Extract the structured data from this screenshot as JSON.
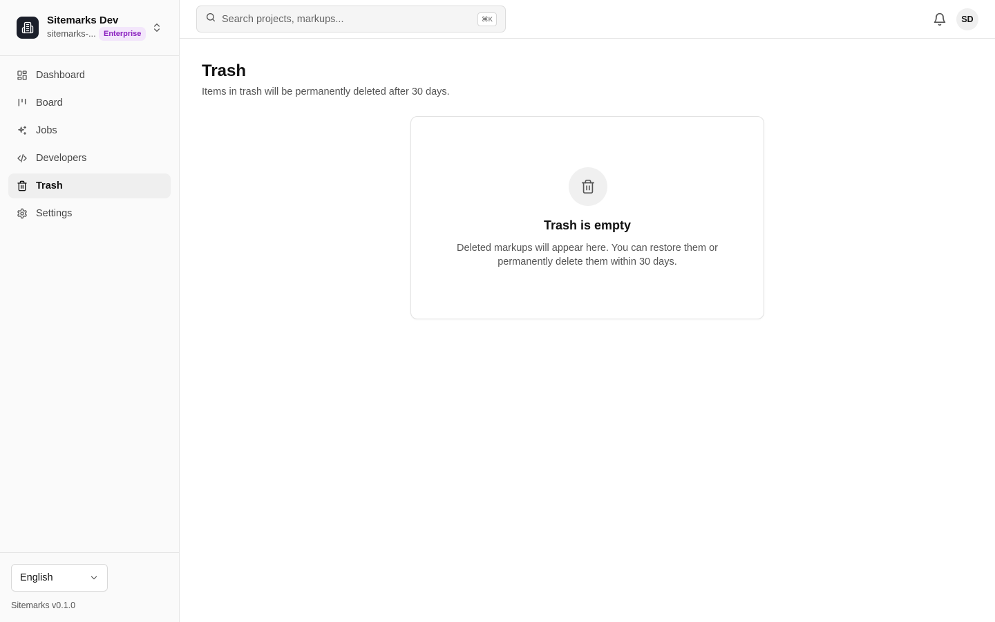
{
  "workspace": {
    "name": "Sitemarks Dev",
    "slug": "sitemarks-...",
    "badge": "Enterprise",
    "logo_icon": "building-icon",
    "switcher_icon": "chevrons-up-down-icon",
    "badge_color": "#8a1fbf"
  },
  "sidebar": {
    "items": [
      {
        "label": "Dashboard",
        "icon": "dashboard-icon",
        "active": false
      },
      {
        "label": "Board",
        "icon": "board-icon",
        "active": false
      },
      {
        "label": "Jobs",
        "icon": "sparkles-icon",
        "active": false
      },
      {
        "label": "Developers",
        "icon": "code-icon",
        "active": false
      },
      {
        "label": "Trash",
        "icon": "trash-icon",
        "active": true
      },
      {
        "label": "Settings",
        "icon": "gear-icon",
        "active": false
      }
    ]
  },
  "footer": {
    "language": "English",
    "version": "Sitemarks v0.1.0"
  },
  "header": {
    "search_placeholder": "Search projects, markups...",
    "shortcut": "⌘K",
    "avatar_initials": "SD",
    "notification_icon": "bell-icon"
  },
  "main": {
    "title": "Trash",
    "subtitle": "Items in trash will be permanently deleted after 30 days.",
    "empty_state": {
      "icon": "trash-icon",
      "title": "Trash is empty",
      "description": "Deleted markups will appear here. You can restore them or permanently delete them within 30 days."
    }
  },
  "colors": {
    "sidebar_bg": "#fafafa",
    "active_item_bg": "#efefef",
    "badge_bg": "#f3e6fb",
    "logo_bg": "#1b1f2a"
  }
}
